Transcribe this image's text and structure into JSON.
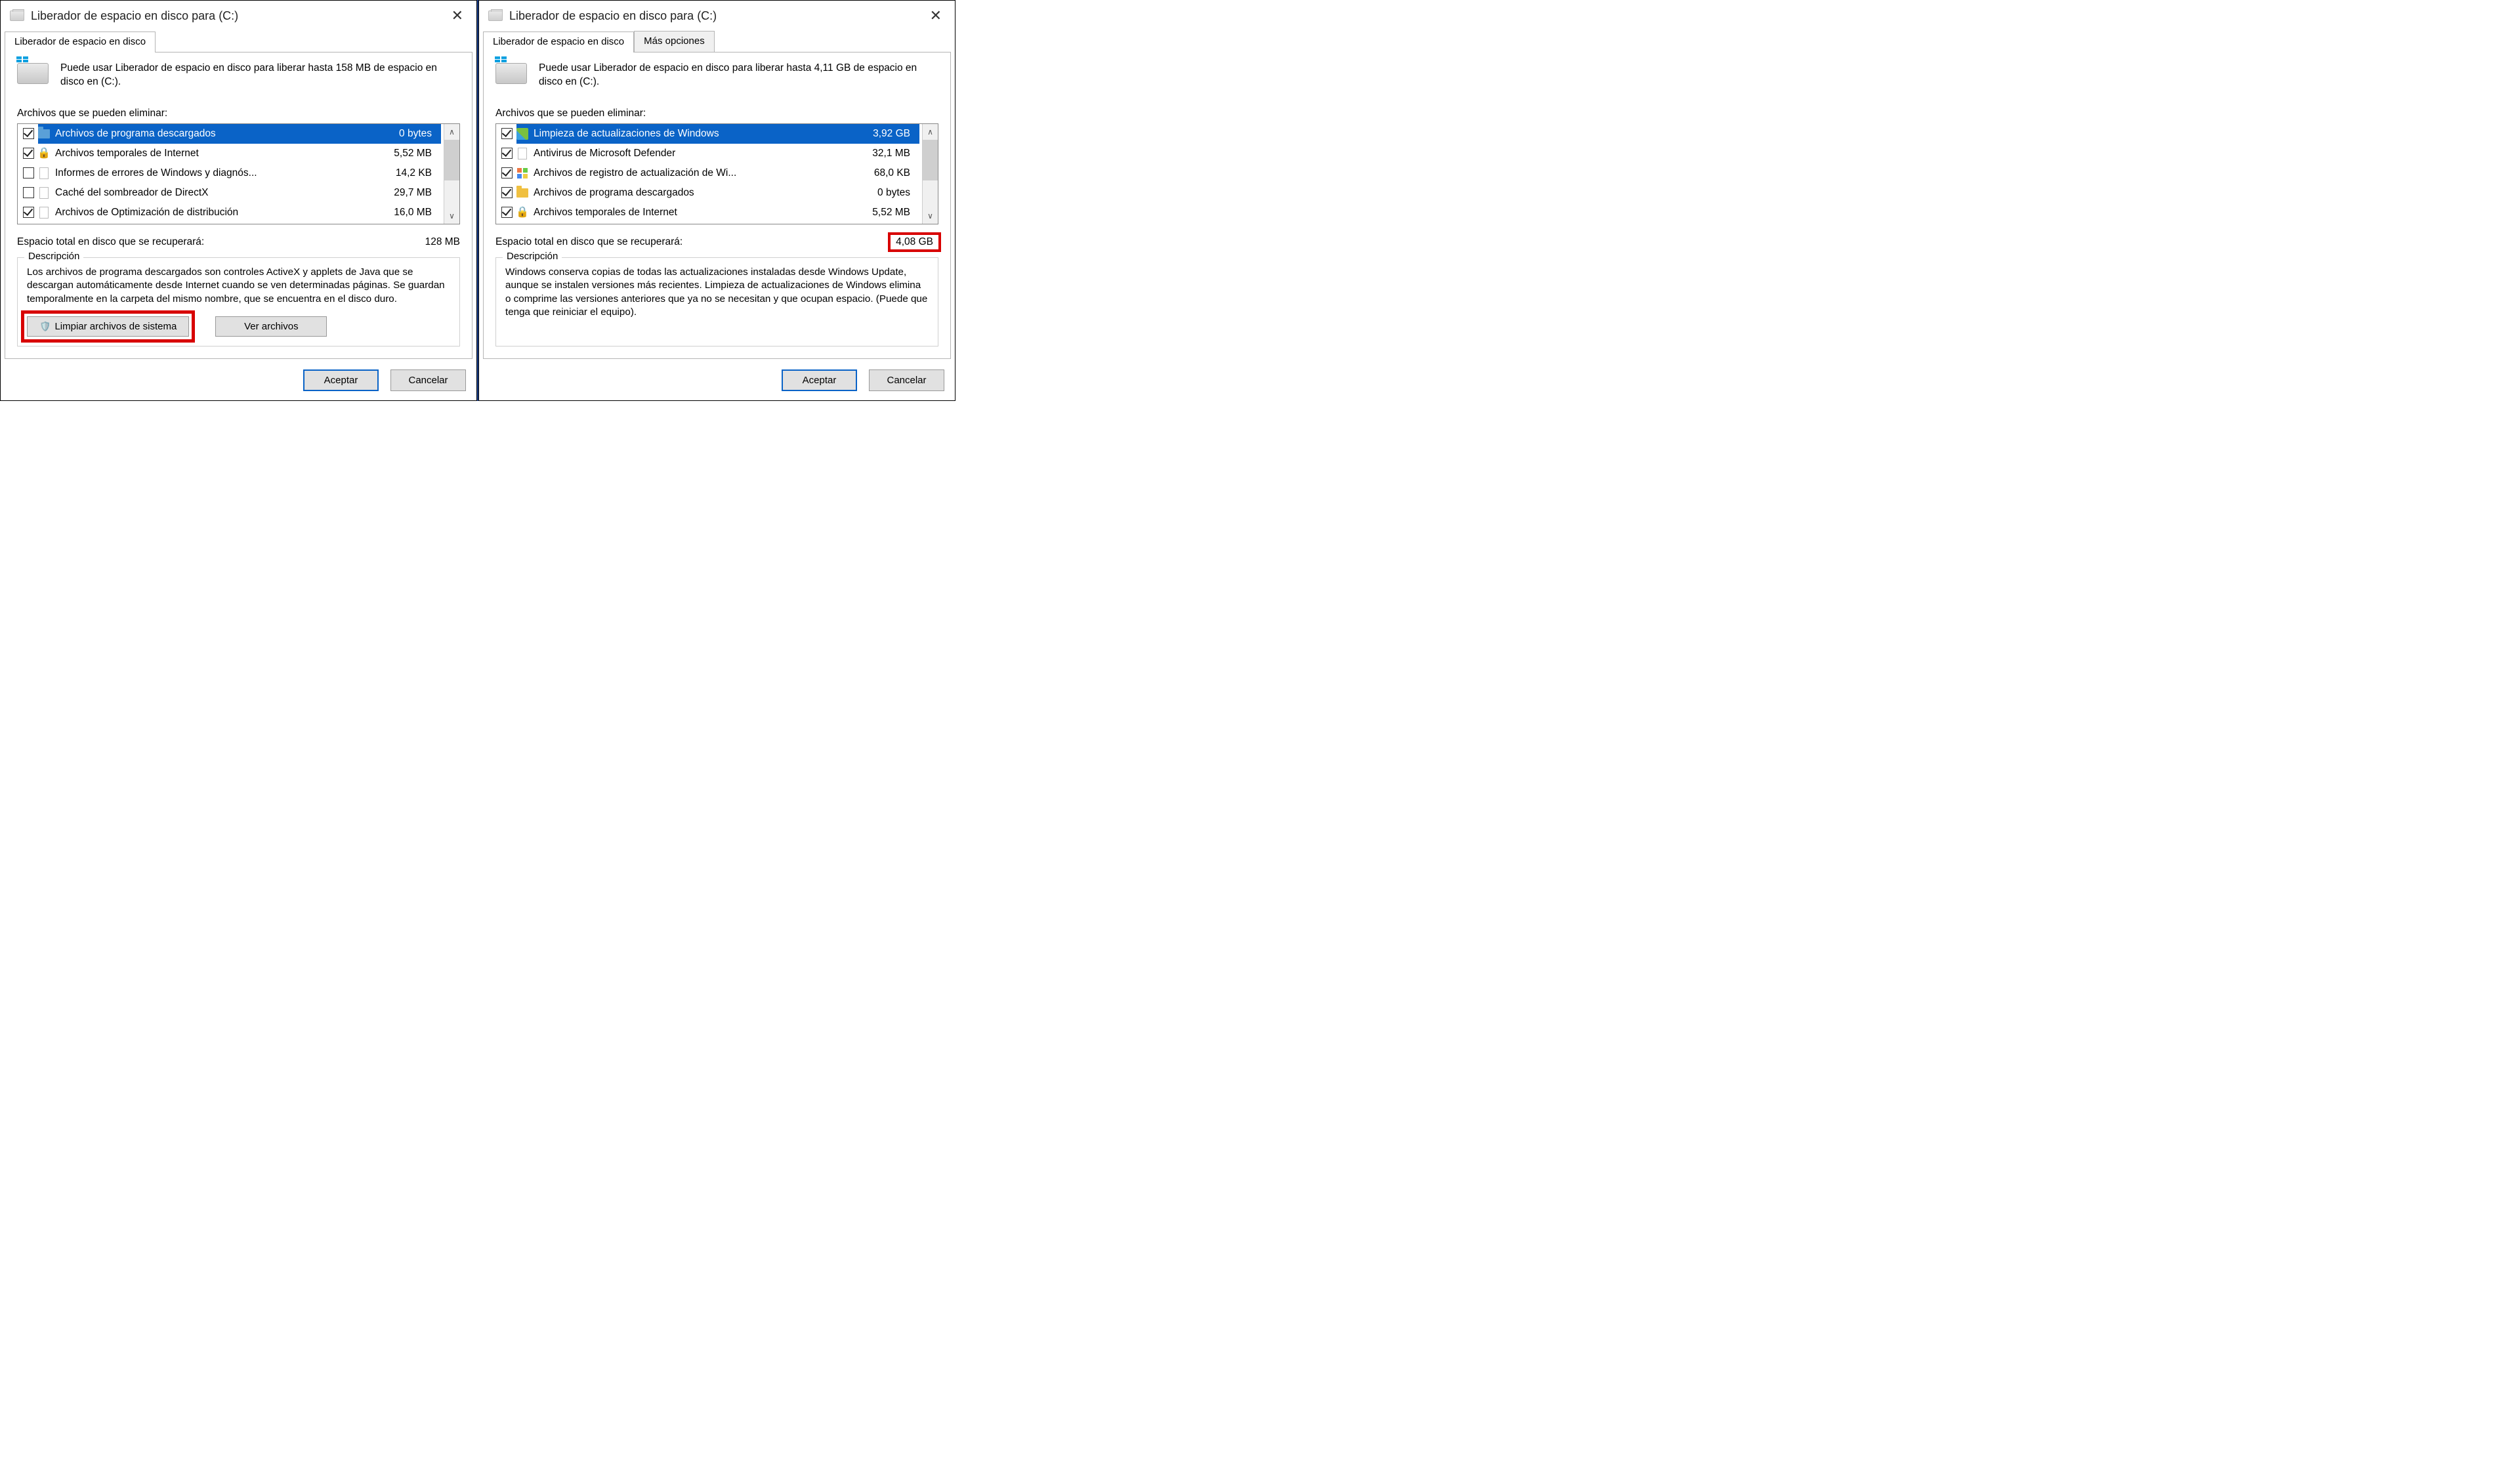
{
  "left": {
    "title": "Liberador de espacio en disco para  (C:)",
    "tabs": [
      "Liberador de espacio en disco"
    ],
    "intro": "Puede usar Liberador de espacio en disco para liberar hasta 158 MB de espacio en disco en  (C:).",
    "files_label": "Archivos que se pueden eliminar:",
    "items": [
      {
        "checked": true,
        "icon": "folder",
        "name": "Archivos de programa descargados",
        "size": "0 bytes",
        "selected": true
      },
      {
        "checked": true,
        "icon": "lock",
        "name": "Archivos temporales de Internet",
        "size": "5,52 MB",
        "selected": false
      },
      {
        "checked": false,
        "icon": "page",
        "name": "Informes de errores de Windows y diagnós...",
        "size": "14,2 KB",
        "selected": false
      },
      {
        "checked": false,
        "icon": "page",
        "name": "Caché del sombreador de DirectX",
        "size": "29,7 MB",
        "selected": false
      },
      {
        "checked": true,
        "icon": "page",
        "name": "Archivos de Optimización de distribución",
        "size": "16,0 MB",
        "selected": false
      }
    ],
    "total_label": "Espacio total en disco que se recuperará:",
    "total_value": "128 MB",
    "desc_legend": "Descripción",
    "desc_text": "Los archivos de programa descargados son controles ActiveX y applets de Java que se descargan automáticamente desde Internet cuando se ven determinadas páginas. Se guardan temporalmente en la carpeta del mismo nombre, que se encuentra en el disco duro.",
    "btn_clean_sys": "Limpiar archivos de sistema",
    "btn_view": "Ver archivos",
    "btn_ok": "Aceptar",
    "btn_cancel": "Cancelar"
  },
  "right": {
    "title": "Liberador de espacio en disco para  (C:)",
    "tabs": [
      "Liberador de espacio en disco",
      "Más opciones"
    ],
    "intro": "Puede usar Liberador de espacio en disco para liberar hasta 4,11 GB de espacio en disco en  (C:).",
    "files_label": "Archivos que se pueden eliminar:",
    "items": [
      {
        "checked": true,
        "icon": "broom",
        "name": "Limpieza de actualizaciones de Windows",
        "size": "3,92 GB",
        "selected": true
      },
      {
        "checked": true,
        "icon": "page",
        "name": "Antivirus de Microsoft Defender",
        "size": "32,1 MB",
        "selected": false
      },
      {
        "checked": true,
        "icon": "win",
        "name": "Archivos de registro de actualización de Wi...",
        "size": "68,0 KB",
        "selected": false
      },
      {
        "checked": true,
        "icon": "foldery",
        "name": "Archivos de programa descargados",
        "size": "0 bytes",
        "selected": false
      },
      {
        "checked": true,
        "icon": "lock",
        "name": "Archivos temporales de Internet",
        "size": "5,52 MB",
        "selected": false
      }
    ],
    "total_label": "Espacio total en disco que se recuperará:",
    "total_value": "4,08 GB",
    "desc_legend": "Descripción",
    "desc_text": "Windows conserva copias de todas las actualizaciones instaladas desde Windows Update, aunque se instalen versiones más recientes. Limpieza de actualizaciones de Windows elimina o comprime las versiones anteriores que ya no se necesitan y que ocupan espacio. (Puede que tenga que reiniciar el equipo).",
    "btn_ok": "Aceptar",
    "btn_cancel": "Cancelar"
  }
}
